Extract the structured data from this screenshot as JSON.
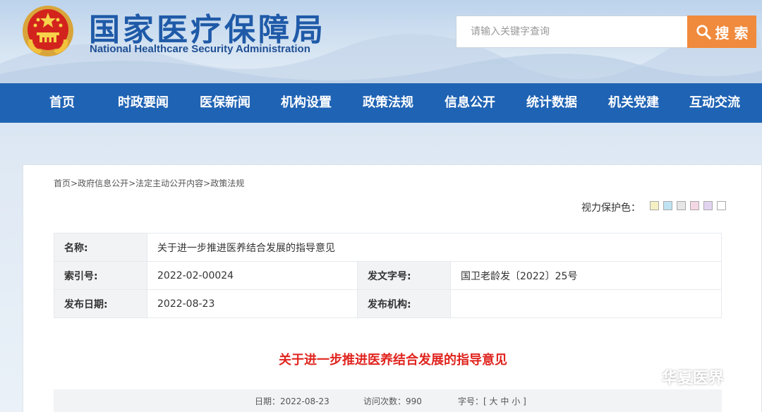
{
  "header": {
    "title": "国家医疗保障局",
    "subtitle": "National Healthcare Security Administration",
    "search_placeholder": "请输入关键字查询",
    "search_button": "搜 索"
  },
  "nav": {
    "items": [
      "首页",
      "时政要闻",
      "医保新闻",
      "机构设置",
      "政策法规",
      "信息公开",
      "统计数据",
      "机关党建",
      "互动交流"
    ]
  },
  "breadcrumb": {
    "items": [
      "首页",
      "政府信息公开",
      "法定主动公开内容",
      "政策法规"
    ],
    "separator": ">"
  },
  "eye_protection": {
    "label": "视力保护色：",
    "colors": [
      "#f5f0c4",
      "#bfe3f2",
      "#e6e6e6",
      "#f4d7e4",
      "#e1d4f0",
      "#ffffff"
    ]
  },
  "meta": {
    "name_label": "名称:",
    "name_value": "关于进一步推进医养结合发展的指导意见",
    "index_label": "索引号:",
    "index_value": "2022-02-00024",
    "doc_no_label": "发文字号:",
    "doc_no_value": "国卫老龄发〔2022〕25号",
    "date_label": "发布日期:",
    "date_value": "2022-08-23",
    "issuer_label": "发布机构:",
    "issuer_value": ""
  },
  "document": {
    "title": "关于进一步推进医养结合发展的指导意见"
  },
  "info_bar": {
    "date_label": "日期：",
    "date_value": "2022-08-23",
    "visits_label": "访问次数：",
    "visits_value": "990",
    "font_label": "字号：",
    "bracket_open": "[",
    "large": "大",
    "medium": "中",
    "small": "小",
    "bracket_close": "]"
  },
  "watermark": {
    "text": "华夏医界"
  },
  "colors": {
    "nav_bg": "#1f63b4",
    "search_button": "#f08a3c",
    "title_red": "#e0251f",
    "brand_blue": "#1f5aa8"
  }
}
